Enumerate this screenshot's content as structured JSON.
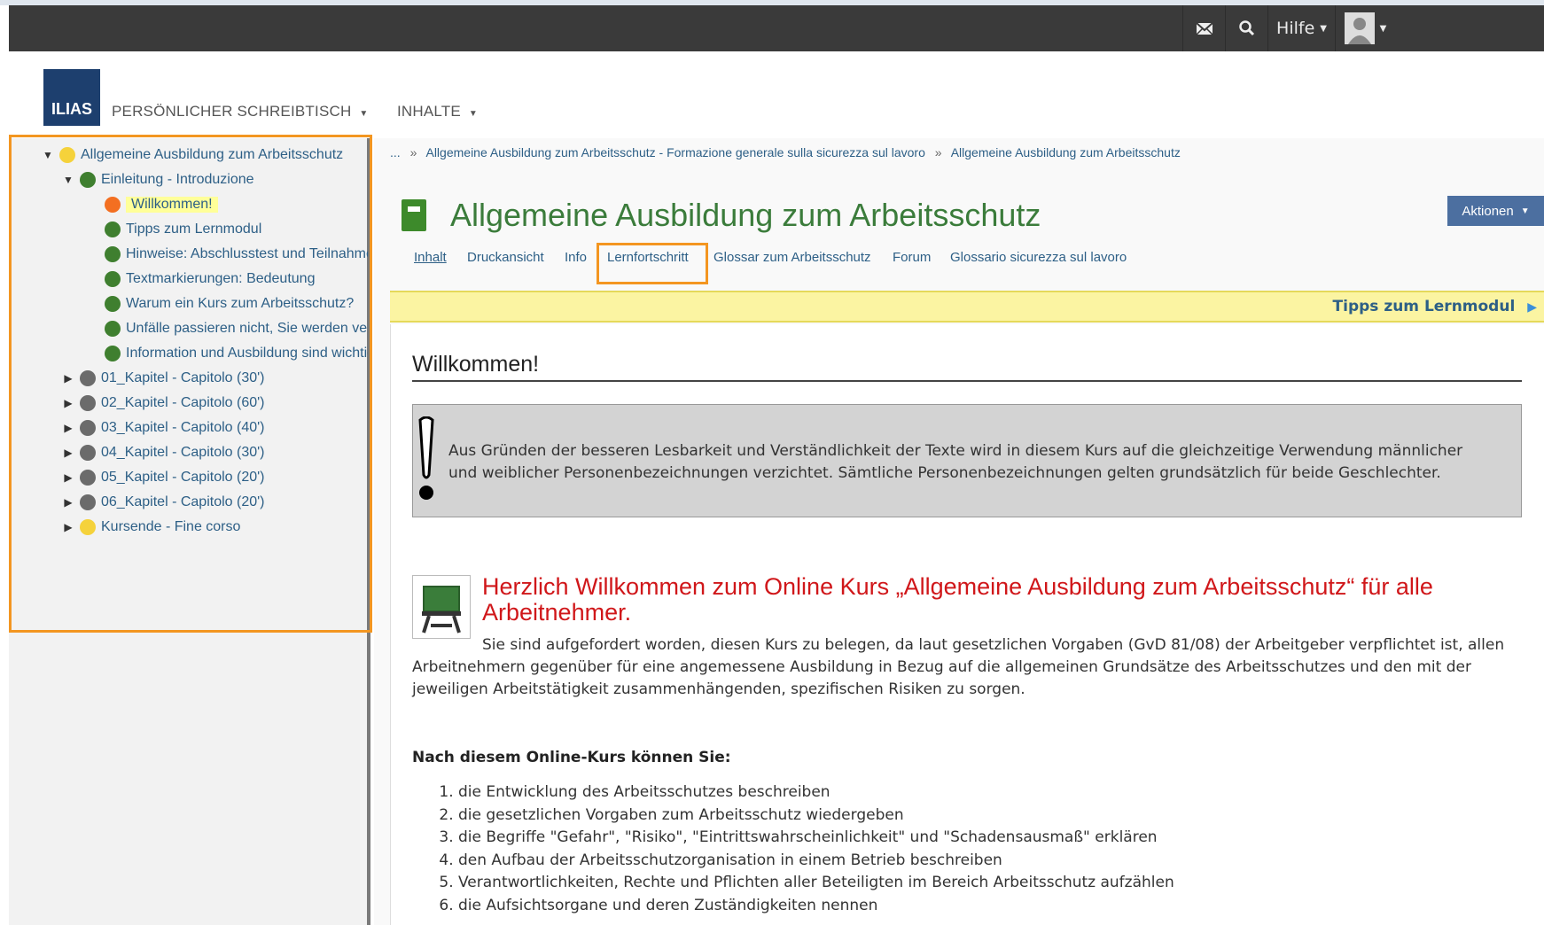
{
  "topbar": {
    "mail_icon": "envelope-icon",
    "search_icon": "search-icon",
    "help_label": "Hilfe",
    "user_icon": "avatar-icon"
  },
  "header": {
    "logo_text": "ILIAS",
    "nav": [
      "PERSÖNLICHER SCHREIBTISCH",
      "INHALTE"
    ]
  },
  "tree": [
    {
      "label": "Allgemeine Ausbildung zum Arbeitsschutz",
      "status": "yellow",
      "expanded": true,
      "level": 0
    },
    {
      "label": "Einleitung - Introduzione",
      "status": "green",
      "expanded": true,
      "level": 1
    },
    {
      "label": "Willkommen!",
      "status": "orange",
      "level": 2,
      "current": true
    },
    {
      "label": "Tipps zum Lernmodul",
      "status": "green",
      "level": 2
    },
    {
      "label": "Hinweise: Abschlusstest und Teilnahme",
      "status": "green",
      "level": 2
    },
    {
      "label": "Textmarkierungen: Bedeutung",
      "status": "green",
      "level": 2
    },
    {
      "label": "Warum ein Kurs zum Arbeitsschutz?",
      "status": "green",
      "level": 2
    },
    {
      "label": "Unfälle passieren nicht, Sie werden verursacht",
      "status": "green",
      "level": 2
    },
    {
      "label": "Information und Ausbildung sind wichtig",
      "status": "green",
      "level": 2
    },
    {
      "label": "01_Kapitel - Capitolo (30')",
      "status": "grey",
      "expanded": false,
      "level": 1
    },
    {
      "label": "02_Kapitel - Capitolo (60')",
      "status": "grey",
      "expanded": false,
      "level": 1
    },
    {
      "label": "03_Kapitel - Capitolo (40')",
      "status": "grey",
      "expanded": false,
      "level": 1
    },
    {
      "label": "04_Kapitel - Capitolo (30')",
      "status": "grey",
      "expanded": false,
      "level": 1
    },
    {
      "label": "05_Kapitel - Capitolo (20')",
      "status": "grey",
      "expanded": false,
      "level": 1
    },
    {
      "label": "06_Kapitel - Capitolo (20')",
      "status": "grey",
      "expanded": false,
      "level": 1
    },
    {
      "label": "Kursende - Fine corso",
      "status": "yellow",
      "expanded": false,
      "level": 1
    }
  ],
  "breadcrumb": {
    "ellipsis": "...",
    "sep": "»",
    "items": [
      "Allgemeine Ausbildung zum Arbeitsschutz - Formazione generale sulla sicurezza sul lavoro",
      "Allgemeine Ausbildung zum Arbeitsschutz"
    ]
  },
  "page": {
    "title": "Allgemeine Ausbildung zum Arbeitsschutz",
    "actions_label": "Aktionen",
    "tabs": [
      "Inhalt",
      "Druckansicht",
      "Info",
      "Lernfortschritt",
      "Glossar zum Arbeitsschutz",
      "Forum",
      "Glossario sicurezza sul lavoro"
    ],
    "active_tab": "Inhalt",
    "next_label": "Tipps zum Lernmodul"
  },
  "content": {
    "heading": "Willkommen!",
    "note": "Aus Gründen der besseren Lesbarkeit und Verständlichkeit der Texte wird in diesem Kurs auf die gleichzeitige Verwendung männlicher und weiblicher Personenbezeichnungen verzichtet. Sämtliche Personenbezeichnungen gelten grundsätzlich für beide Geschlechter.",
    "welcome_heading": "Herzlich Willkommen zum Online Kurs „Allgemeine Ausbildung zum Arbeitsschutz“ für alle Arbeitnehmer.",
    "intro": "Sie sind aufgefordert worden, diesen Kurs zu belegen, da laut gesetzlichen Vorgaben (GvD 81/08) der Arbeitgeber verpflichtet ist, allen Arbeitnehmern gegenüber für eine angemessene Ausbildung in Bezug auf die allgemeinen Grundsätze des Arbeitsschutzes und den mit der jeweiligen Arbeitstätigkeit zusammenhängenden, spezifischen Risiken zu sorgen.",
    "goals_heading": "Nach diesem Online-Kurs können Sie:",
    "goals": [
      "die Entwicklung des Arbeitsschutzes beschreiben",
      "die gesetzlichen Vorgaben zum Arbeitsschutz wiedergeben",
      "die Begriffe \"Gefahr\", \"Risiko\", \"Eintrittswahrscheinlichkeit\" und \"Schadensausmaß\" erklären",
      "den Aufbau der Arbeitsschutzorganisation in einem Betrieb beschreiben",
      "Verantwortlichkeiten, Rechte und Pflichten aller Beteiligten im Bereich Arbeitsschutz aufzählen",
      "die Aufsichtsorgane und deren Zuständigkeiten nennen"
    ]
  },
  "colors": {
    "highlight": "#f39621",
    "title_green": "#3b7c3b",
    "welcome_red": "#d0171a",
    "link_blue": "#2d5f86"
  }
}
